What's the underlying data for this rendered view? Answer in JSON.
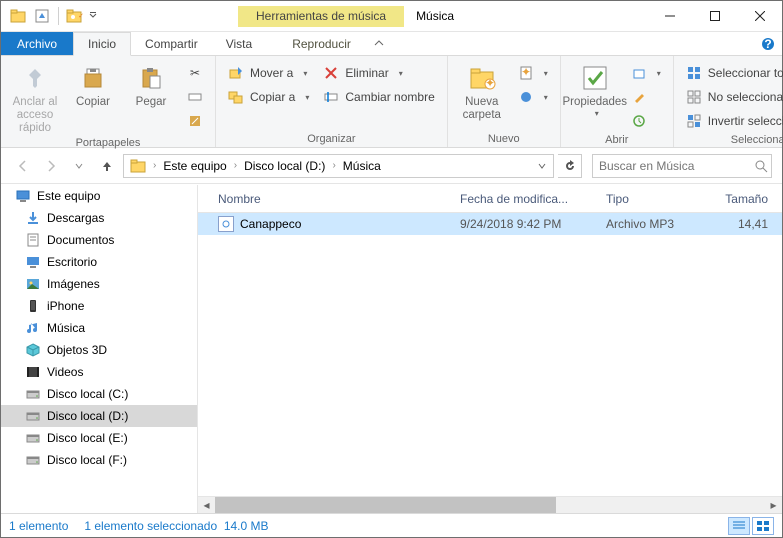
{
  "title": "Música",
  "context_tab": "Herramientas de música",
  "tabs": {
    "file": "Archivo",
    "home": "Inicio",
    "share": "Compartir",
    "view": "Vista",
    "play": "Reproducir"
  },
  "ribbon": {
    "clipboard": {
      "label": "Portapapeles",
      "pin": "Anclar al acceso rápido",
      "copy": "Copiar",
      "paste": "Pegar"
    },
    "organize": {
      "label": "Organizar",
      "move_to": "Mover a",
      "copy_to": "Copiar a",
      "delete": "Eliminar",
      "rename": "Cambiar nombre"
    },
    "new": {
      "label": "Nuevo",
      "new_folder": "Nueva carpeta"
    },
    "open": {
      "label": "Abrir",
      "properties": "Propiedades"
    },
    "select": {
      "label": "Seleccionar",
      "select_all": "Seleccionar todo",
      "select_none": "No seleccionar ninguno",
      "invert": "Invertir selección"
    }
  },
  "breadcrumb": {
    "items": [
      "Este equipo",
      "Disco local (D:)",
      "Música"
    ]
  },
  "search": {
    "placeholder": "Buscar en Música"
  },
  "sidebar": {
    "root": "Este equipo",
    "items": [
      {
        "icon": "download",
        "label": "Descargas"
      },
      {
        "icon": "document",
        "label": "Documentos"
      },
      {
        "icon": "desktop",
        "label": "Escritorio"
      },
      {
        "icon": "image",
        "label": "Imágenes"
      },
      {
        "icon": "phone",
        "label": "iPhone"
      },
      {
        "icon": "music",
        "label": "Música"
      },
      {
        "icon": "cube",
        "label": "Objetos 3D"
      },
      {
        "icon": "video",
        "label": "Videos"
      },
      {
        "icon": "disk",
        "label": "Disco local (C:)"
      },
      {
        "icon": "disk",
        "label": "Disco local (D:)"
      },
      {
        "icon": "disk",
        "label": "Disco local (E:)"
      },
      {
        "icon": "disk",
        "label": "Disco local (F:)"
      }
    ],
    "selected_index": 9
  },
  "columns": {
    "name": "Nombre",
    "date": "Fecha de modifica...",
    "type": "Tipo",
    "size": "Tamaño"
  },
  "files": {
    "items": [
      {
        "name": "Canappeco",
        "date": "9/24/2018 9:42 PM",
        "type": "Archivo MP3",
        "size": "14,41"
      }
    ],
    "selected_index": 0
  },
  "status": {
    "count": "1 elemento",
    "selection": "1 elemento seleccionado",
    "size": "14.0 MB"
  }
}
